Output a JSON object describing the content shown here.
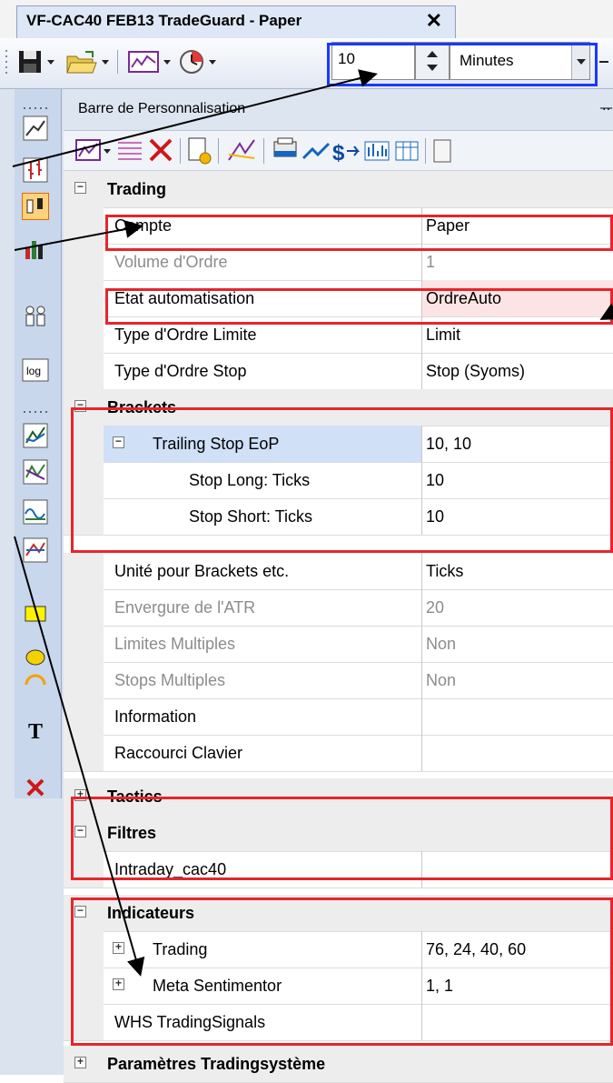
{
  "window": {
    "tab_title": "VF-CAC40 FEB13  TradeGuard - Paper",
    "close_glyph": "✕"
  },
  "toolbar": {
    "interval_value": "10",
    "interval_unit": "Minutes",
    "icons": [
      "save-icon",
      "open-folder-icon",
      "chart-icon",
      "clock-icon"
    ]
  },
  "left_toolbar": {
    "log_label": "log",
    "text_tool": "T",
    "delete_glyph": "✕"
  },
  "panel": {
    "title": "Barre de Personnalisation",
    "pin_glyph": "ᅲ"
  },
  "grid": {
    "trading": {
      "label": "Trading",
      "compte": {
        "name": "Compte",
        "value": "Paper"
      },
      "volume": {
        "name": "Volume d'Ordre",
        "value": "1"
      },
      "etat": {
        "name": "Etat automatisation",
        "value": "OrdreAuto"
      },
      "type_limite": {
        "name": "Type d'Ordre Limite",
        "value": "Limit"
      },
      "type_stop": {
        "name": "Type d'Ordre Stop",
        "value": "Stop (Syoms)"
      }
    },
    "brackets": {
      "label": "Brackets",
      "trailing": {
        "name": "Trailing Stop EoP",
        "value": "10, 10"
      },
      "stop_long": {
        "name": "Stop Long: Ticks",
        "value": "10"
      },
      "stop_short": {
        "name": "Stop Short: Ticks",
        "value": "10"
      }
    },
    "unite": {
      "name": "Unité pour Brackets etc.",
      "value": "Ticks"
    },
    "envergure": {
      "name": "Envergure de l'ATR",
      "value": "20"
    },
    "limites": {
      "name": "Limites Multiples",
      "value": "Non"
    },
    "stops": {
      "name": "Stops Multiples",
      "value": "Non"
    },
    "information": {
      "name": "Information",
      "value": ""
    },
    "raccourci": {
      "name": "Raccourci Clavier",
      "value": ""
    },
    "tactics": {
      "label": "Tactics"
    },
    "filtres": {
      "label": "Filtres",
      "intraday": {
        "name": "Intraday_cac40",
        "value": ""
      }
    },
    "indicateurs": {
      "label": "Indicateurs",
      "trading": {
        "name": "Trading",
        "value": "76, 24, 40, 60"
      },
      "meta": {
        "name": "Meta Sentimentor",
        "value": "1, 1"
      },
      "whs": {
        "name": "WHS TradingSignals",
        "value": ""
      }
    },
    "parametres": {
      "label": "Paramètres Tradingsystème"
    }
  },
  "colors": {
    "highlight_red": "#e8242b",
    "focus_blue": "#1a39ff",
    "selected_value_bg": "#fde4e4",
    "selected_name_bg": "#cfe0f7"
  }
}
